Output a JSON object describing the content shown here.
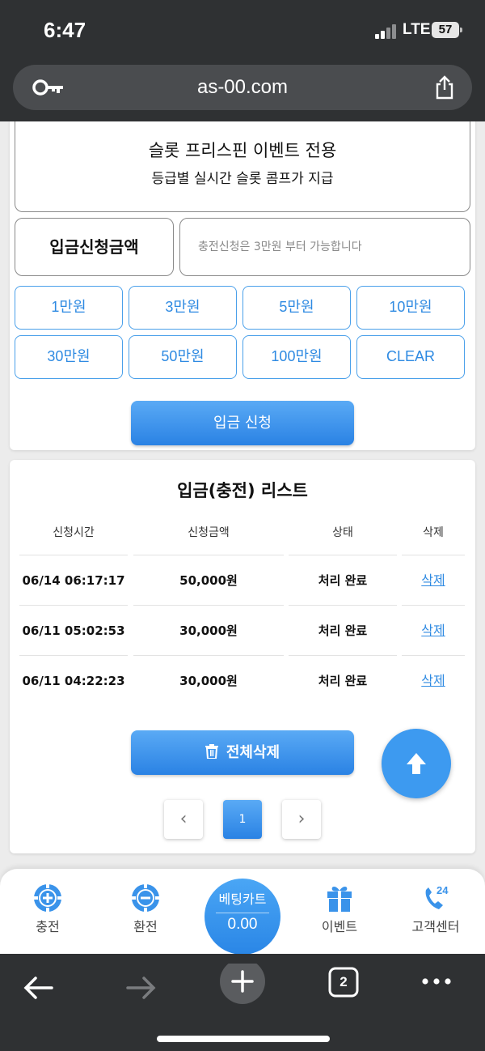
{
  "status_bar": {
    "time": "6:47",
    "network": "LTE",
    "battery": "57"
  },
  "browser": {
    "url": "as-00.com",
    "tab_count": "2"
  },
  "event": {
    "title": "슬롯 프리스핀 이벤트 전용",
    "subtitle": "등급별 실시간 슬롯 콤프가 지급"
  },
  "deposit": {
    "amount_label": "입금신청금액",
    "amount_placeholder": "충전신청은 3만원 부터 가능합니다",
    "amount_buttons": [
      "1만원",
      "3만원",
      "5만원",
      "10만원",
      "30만원",
      "50만원",
      "100만원",
      "CLEAR"
    ],
    "submit_label": "입금 신청"
  },
  "list": {
    "title": "입금(충전) 리스트",
    "headers": [
      "신청시간",
      "신청금액",
      "상태",
      "삭제"
    ],
    "rows": [
      {
        "time": "06/14 06:17:17",
        "amount": "50,000원",
        "status": "처리 완료",
        "delete": "삭제"
      },
      {
        "time": "06/11 05:02:53",
        "amount": "30,000원",
        "status": "처리 완료",
        "delete": "삭제"
      },
      {
        "time": "06/11 04:22:23",
        "amount": "30,000원",
        "status": "처리 완료",
        "delete": "삭제"
      }
    ],
    "delete_all_label": "전체삭제",
    "pagination": {
      "prev": "‹",
      "current": "1",
      "next": "›"
    }
  },
  "bottom_nav": {
    "items": [
      {
        "label": "충전",
        "icon": "chip-plus-icon"
      },
      {
        "label": "환전",
        "icon": "chip-minus-icon"
      },
      {
        "label": "이벤트",
        "icon": "gift-icon"
      },
      {
        "label": "고객센터",
        "icon": "phone-24-icon"
      }
    ],
    "bet_cart": {
      "label": "베팅카트",
      "value": "0.00"
    }
  },
  "colors": {
    "accent": "#2e8ae2",
    "accent_light": "#5aaaf5",
    "browser_chrome": "#2f3133"
  }
}
